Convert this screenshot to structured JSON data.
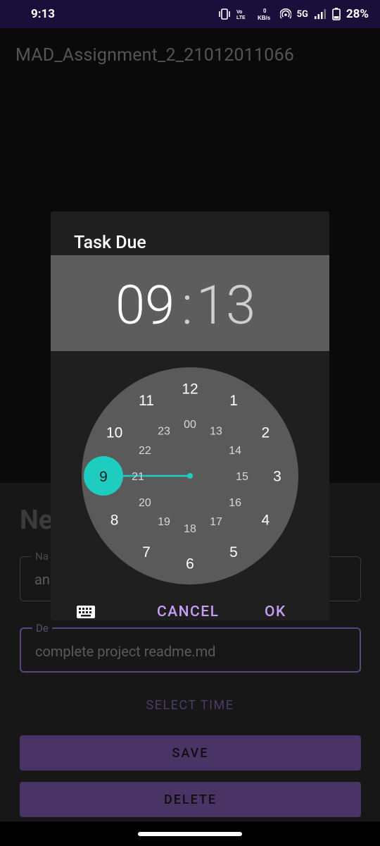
{
  "status_bar": {
    "time": "9:13",
    "icons": [
      "vibrate-icon",
      "volte-icon",
      "data-speed-icon",
      "hotspot-icon",
      "signal-icon",
      "battery-icon"
    ],
    "net_speed": "0\nKB/s",
    "network": "5G",
    "battery": "28%"
  },
  "app": {
    "title": "MAD_Assignment_2_21012011066"
  },
  "form": {
    "heading": "Ne",
    "name_label": "Na",
    "name_value": "an",
    "desc_label": "De",
    "desc_value": "complete project readme.md",
    "select_time": "SELECT TIME",
    "save": "SAVE",
    "delete": "DELETE"
  },
  "dialog": {
    "title": "Task Due",
    "hour": "09",
    "colon": ":",
    "minute": "13",
    "cancel": "CANCEL",
    "ok": "OK",
    "selected_hour": "9",
    "outer_ring": [
      "12",
      "1",
      "2",
      "3",
      "4",
      "5",
      "6",
      "7",
      "8",
      "9",
      "10",
      "11"
    ],
    "inner_ring": [
      "00",
      "13",
      "14",
      "15",
      "16",
      "17",
      "18",
      "19",
      "20",
      "21",
      "22",
      "23"
    ]
  },
  "colors": {
    "accent": "#c89df5",
    "selector": "#1ecdbf",
    "clock_face": "#5a5a5a",
    "button_bg": "#4a3466"
  }
}
